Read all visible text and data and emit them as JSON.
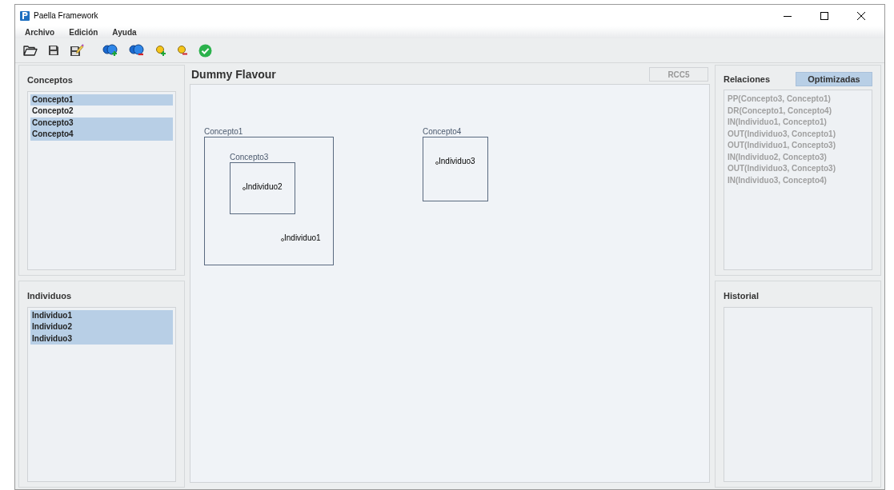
{
  "window": {
    "title": "Paella Framework"
  },
  "menu": [
    "Archivo",
    "Edición",
    "Ayuda"
  ],
  "toolbar": [
    {
      "kind": "open"
    },
    {
      "kind": "save"
    },
    {
      "kind": "save-edit"
    },
    {
      "kind": "concept-add"
    },
    {
      "kind": "concept-remove"
    },
    {
      "kind": "individual-add"
    },
    {
      "kind": "individual-remove"
    },
    {
      "kind": "validate"
    }
  ],
  "conceptos": {
    "title": "Conceptos",
    "items": [
      {
        "label": "Concepto1",
        "selected": true
      },
      {
        "label": "Concepto2",
        "selected": false
      },
      {
        "label": "Concepto3",
        "selected": true
      },
      {
        "label": "Concepto4",
        "selected": true
      }
    ]
  },
  "individuos": {
    "title": "Individuos",
    "items": [
      {
        "label": "Individuo1",
        "selected": true
      },
      {
        "label": "Individuo2",
        "selected": true
      },
      {
        "label": "Individuo3",
        "selected": true
      }
    ]
  },
  "canvas": {
    "title": "Dummy Flavour",
    "mode_button": "RCC5",
    "regions": [
      {
        "label": "Concepto1",
        "individuals": [
          "Individuo1"
        ],
        "children": [
          {
            "label": "Concepto3",
            "individuals": [
              "Individuo2"
            ]
          }
        ]
      },
      {
        "label": "Concepto4",
        "individuals": [
          "Individuo3"
        ]
      }
    ]
  },
  "relaciones": {
    "title": "Relaciones",
    "toggle": {
      "label": "Optimizadas",
      "selected": true
    },
    "items": [
      "PP(Concepto3, Concepto1)",
      "DR(Concepto1, Concepto4)",
      "IN(Individuo1, Concepto1)",
      "OUT(Individuo3, Concepto1)",
      "OUT(Individuo1, Concepto3)",
      "IN(Individuo2, Concepto3)",
      "OUT(Individuo3, Concepto3)",
      "IN(Individuo3, Concepto4)"
    ]
  },
  "historial": {
    "title": "Historial"
  }
}
